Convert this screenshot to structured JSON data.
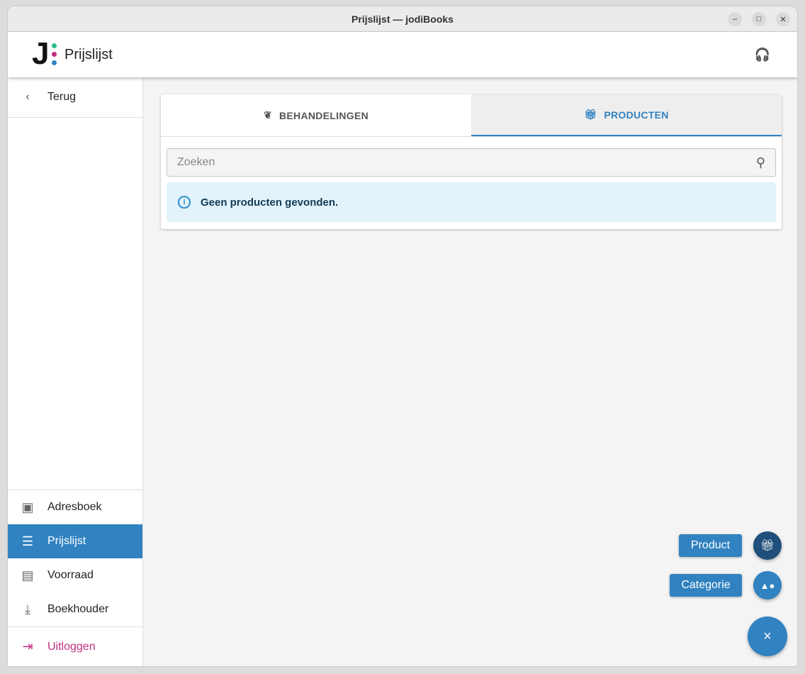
{
  "window": {
    "title": "Prijslijst — jodiBooks"
  },
  "header": {
    "title": "Prijslijst",
    "logo_letter": "J"
  },
  "colors": {
    "accent": "#3182c0",
    "logout": "#c0307f",
    "alert_bg": "#e3f3fb"
  },
  "sidebar": {
    "back": "Terug",
    "items": [
      {
        "label": "Adresboek",
        "icon": "contact-book-icon"
      },
      {
        "label": "Prijslijst",
        "icon": "list-icon",
        "active": true
      },
      {
        "label": "Voorraad",
        "icon": "archive-box-icon"
      },
      {
        "label": "Boekhouder",
        "icon": "download-icon"
      }
    ],
    "logout": "Uitloggen"
  },
  "tabs": [
    {
      "label": "BEHANDELINGEN",
      "icon": "lotus-icon"
    },
    {
      "label": "PRODUCTEN",
      "icon": "gift-card-icon",
      "active": true
    }
  ],
  "search": {
    "placeholder": "Zoeken",
    "value": ""
  },
  "alert": {
    "text": "Geen producten gevonden."
  },
  "fab": {
    "product": "Product",
    "categorie": "Categorie",
    "close": "×"
  }
}
